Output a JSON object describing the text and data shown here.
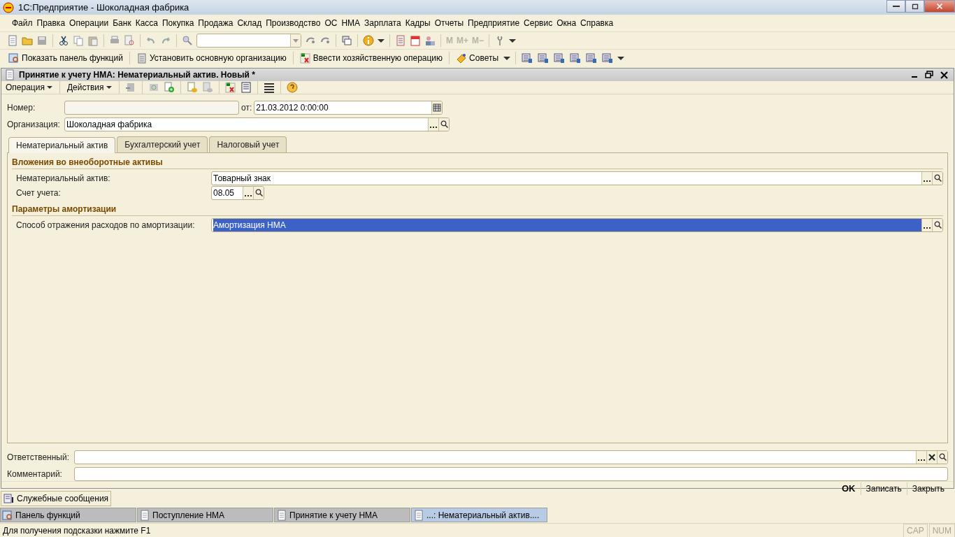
{
  "window": {
    "title": "1С:Предприятие - Шоколадная фабрика"
  },
  "menu": [
    "Файл",
    "Правка",
    "Операции",
    "Банк",
    "Касса",
    "Покупка",
    "Продажа",
    "Склад",
    "Производство",
    "ОС",
    "НМА",
    "Зарплата",
    "Кадры",
    "Отчеты",
    "Предприятие",
    "Сервис",
    "Окна",
    "Справка"
  ],
  "memory_buttons": [
    {
      "label": "M",
      "disabled": true
    },
    {
      "label": "M+",
      "disabled": true
    },
    {
      "label": "M−",
      "disabled": true
    }
  ],
  "function_toolbar": [
    "Показать панель функций",
    "Установить основную организацию",
    "Ввести хозяйственную операцию",
    "Советы"
  ],
  "document": {
    "title": "Принятие к учету НМА: Нематериальный актив. Новый *",
    "toolbar_menus": [
      "Операция",
      "Действия"
    ],
    "number": {
      "label": "Номер:"
    },
    "date": {
      "label": "от:",
      "value": "21.03.2012  0:00:00"
    },
    "organization": {
      "label": "Организация:",
      "value": "Шоколадная фабрика"
    },
    "tabs": [
      {
        "label": "Нематериальный актив",
        "selected": true
      },
      {
        "label": "Бухгалтерский учет",
        "selected": false
      },
      {
        "label": "Налоговый учет",
        "selected": false
      }
    ],
    "sections": [
      {
        "title": "Вложения во внеоборотные активы",
        "fields": [
          {
            "label": "Нематериальный актив:",
            "value": "Товарный знак",
            "kind": "wide",
            "selected": false
          },
          {
            "label": "Счет учета:",
            "value": "08.05",
            "kind": "short",
            "selected": false
          }
        ]
      },
      {
        "title": "Параметры амортизации",
        "fields": [
          {
            "label": "Способ отражения расходов по амортизации:",
            "value": "Амортизация НМА",
            "kind": "wide",
            "selected": true
          }
        ]
      }
    ],
    "responsible": {
      "label": "Ответственный:"
    },
    "comment": {
      "label": "Комментарий:"
    },
    "buttons": [
      {
        "label": "OK",
        "default": true
      },
      {
        "label": "Записать",
        "default": false
      },
      {
        "label": "Закрыть",
        "default": false
      }
    ]
  },
  "messages_button": "Служебные сообщения",
  "taskbar": [
    {
      "label": "Панель функций",
      "selected": false
    },
    {
      "label": "Поступление НМА",
      "selected": false
    },
    {
      "label": "Принятие к учету НМА",
      "selected": false
    },
    {
      "label": "...: Нематериальный актив....",
      "selected": true
    }
  ],
  "status_bar": {
    "hint": "Для получения подсказки нажмите F1",
    "indicators": [
      "CAP",
      "NUM"
    ]
  }
}
